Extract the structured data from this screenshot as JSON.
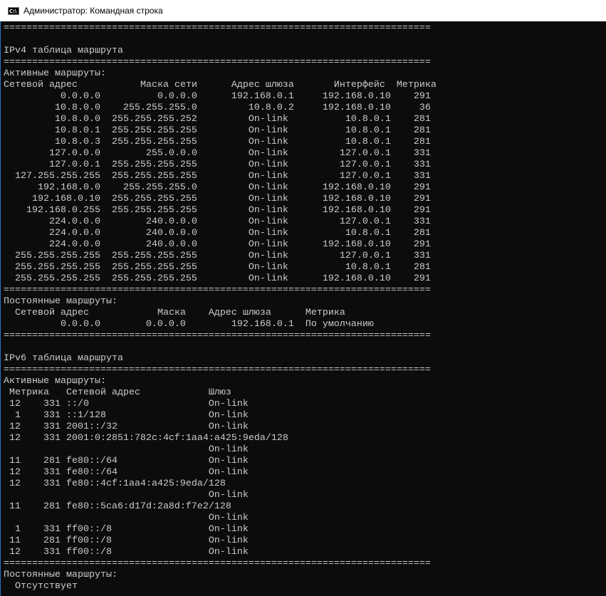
{
  "window": {
    "title": "Администратор: Командная строка",
    "icon": "cmd-icon"
  },
  "separator": "===========================================================================",
  "ipv4": {
    "title": "IPv4 таблица маршрута",
    "active_title": "Активные маршруты:",
    "active_header": "Сетевой адрес           Маска сети      Адрес шлюза       Интерфейс  Метрика",
    "active_routes": [
      [
        "0.0.0.0",
        "0.0.0.0",
        "192.168.0.1",
        "192.168.0.10",
        "291"
      ],
      [
        "10.8.0.0",
        "255.255.255.0",
        "10.8.0.2",
        "192.168.0.10",
        "36"
      ],
      [
        "10.8.0.0",
        "255.255.255.252",
        "On-link",
        "10.8.0.1",
        "281"
      ],
      [
        "10.8.0.1",
        "255.255.255.255",
        "On-link",
        "10.8.0.1",
        "281"
      ],
      [
        "10.8.0.3",
        "255.255.255.255",
        "On-link",
        "10.8.0.1",
        "281"
      ],
      [
        "127.0.0.0",
        "255.0.0.0",
        "On-link",
        "127.0.0.1",
        "331"
      ],
      [
        "127.0.0.1",
        "255.255.255.255",
        "On-link",
        "127.0.0.1",
        "331"
      ],
      [
        "127.255.255.255",
        "255.255.255.255",
        "On-link",
        "127.0.0.1",
        "331"
      ],
      [
        "192.168.0.0",
        "255.255.255.0",
        "On-link",
        "192.168.0.10",
        "291"
      ],
      [
        "192.168.0.10",
        "255.255.255.255",
        "On-link",
        "192.168.0.10",
        "291"
      ],
      [
        "192.168.0.255",
        "255.255.255.255",
        "On-link",
        "192.168.0.10",
        "291"
      ],
      [
        "224.0.0.0",
        "240.0.0.0",
        "On-link",
        "127.0.0.1",
        "331"
      ],
      [
        "224.0.0.0",
        "240.0.0.0",
        "On-link",
        "10.8.0.1",
        "281"
      ],
      [
        "224.0.0.0",
        "240.0.0.0",
        "On-link",
        "192.168.0.10",
        "291"
      ],
      [
        "255.255.255.255",
        "255.255.255.255",
        "On-link",
        "127.0.0.1",
        "331"
      ],
      [
        "255.255.255.255",
        "255.255.255.255",
        "On-link",
        "10.8.0.1",
        "281"
      ],
      [
        "255.255.255.255",
        "255.255.255.255",
        "On-link",
        "192.168.0.10",
        "291"
      ]
    ],
    "persistent_title": "Постоянные маршруты:",
    "persistent_header": "  Сетевой адрес            Маска    Адрес шлюза      Метрика",
    "persistent_routes": [
      [
        "0.0.0.0",
        "0.0.0.0",
        "192.168.0.1",
        "По умолчанию"
      ]
    ]
  },
  "ipv6": {
    "title": "IPv6 таблица маршрута",
    "active_title": "Активные маршруты:",
    "active_header": " Метрика   Сетевой адрес            Шлюз",
    "active_routes": [
      [
        "12",
        "331",
        "::/0",
        "On-link"
      ],
      [
        "1",
        "331",
        "::1/128",
        "On-link"
      ],
      [
        "12",
        "331",
        "2001::/32",
        "On-link"
      ],
      [
        "12",
        "331",
        "2001:0:2851:782c:4cf:1aa4:a425:9eda/128",
        "On-link"
      ],
      [
        "11",
        "281",
        "fe80::/64",
        "On-link"
      ],
      [
        "12",
        "331",
        "fe80::/64",
        "On-link"
      ],
      [
        "12",
        "331",
        "fe80::4cf:1aa4:a425:9eda/128",
        "On-link"
      ],
      [
        "11",
        "281",
        "fe80::5ca6:d17d:2a8d:f7e2/128",
        "On-link"
      ],
      [
        "1",
        "331",
        "ff00::/8",
        "On-link"
      ],
      [
        "11",
        "281",
        "ff00::/8",
        "On-link"
      ],
      [
        "12",
        "331",
        "ff00::/8",
        "On-link"
      ]
    ],
    "persistent_title": "Постоянные маршруты:",
    "persistent_value": "  Отсутствует"
  }
}
